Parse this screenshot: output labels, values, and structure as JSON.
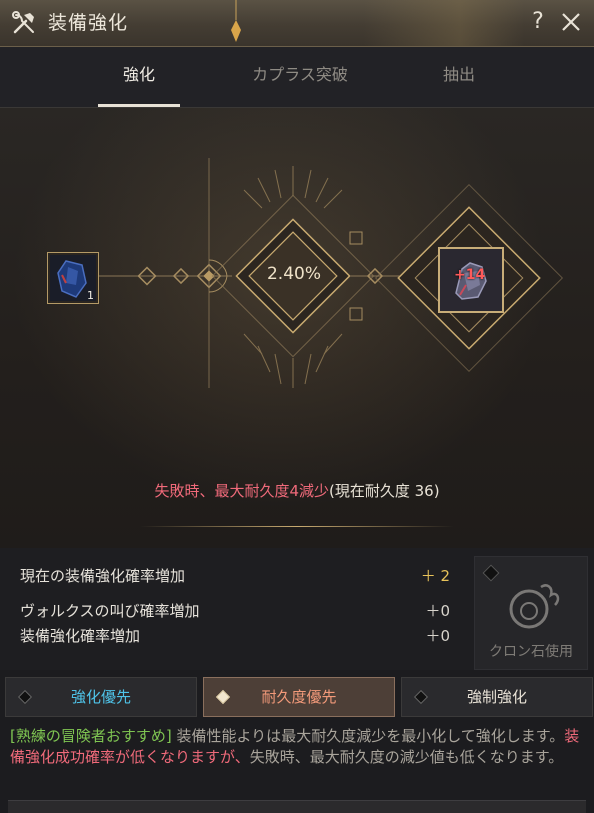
{
  "window": {
    "title": "装備強化"
  },
  "tabs": [
    {
      "label": "強化",
      "active": true
    },
    {
      "label": "カプラス突破",
      "active": false
    },
    {
      "label": "抽出",
      "active": false
    }
  ],
  "enhance": {
    "rate": "2.40%",
    "material_count": "1",
    "target_level": "+14",
    "fail_main": "失敗時、最大耐久度4減少",
    "fail_sub": "(現在耐久度 36)"
  },
  "stats": [
    {
      "label": "現在の装備強化確率増加",
      "value": "＋ 2",
      "color": "#e8c35a"
    },
    {
      "label": "ヴォルクスの叫び確率増加",
      "value": "＋0",
      "color": "#d8d4cc"
    },
    {
      "label": "装備強化確率増加",
      "value": "＋0",
      "color": "#d8d4cc"
    }
  ],
  "clone": {
    "label": "クロン石使用"
  },
  "modes": [
    {
      "label": "強化優先",
      "color": "#4fc3e8",
      "selected": false
    },
    {
      "label": "耐久度優先",
      "color": "#f39a7a",
      "selected": true
    },
    {
      "label": "強制強化",
      "color": "#e8e2d6",
      "selected": false
    }
  ],
  "description": {
    "tag": "[熟練の冒険者おすすめ]",
    "text1": " 装備性能よりは最大耐久度減少を最小化して強化します。",
    "warn": "装備強化成功確率が低くなりますが、",
    "text2": "失敗時、最大耐久度の減少値も低くなります。"
  },
  "colors": {
    "gold": "#c8aa70",
    "accent_red": "#f06a7a"
  }
}
